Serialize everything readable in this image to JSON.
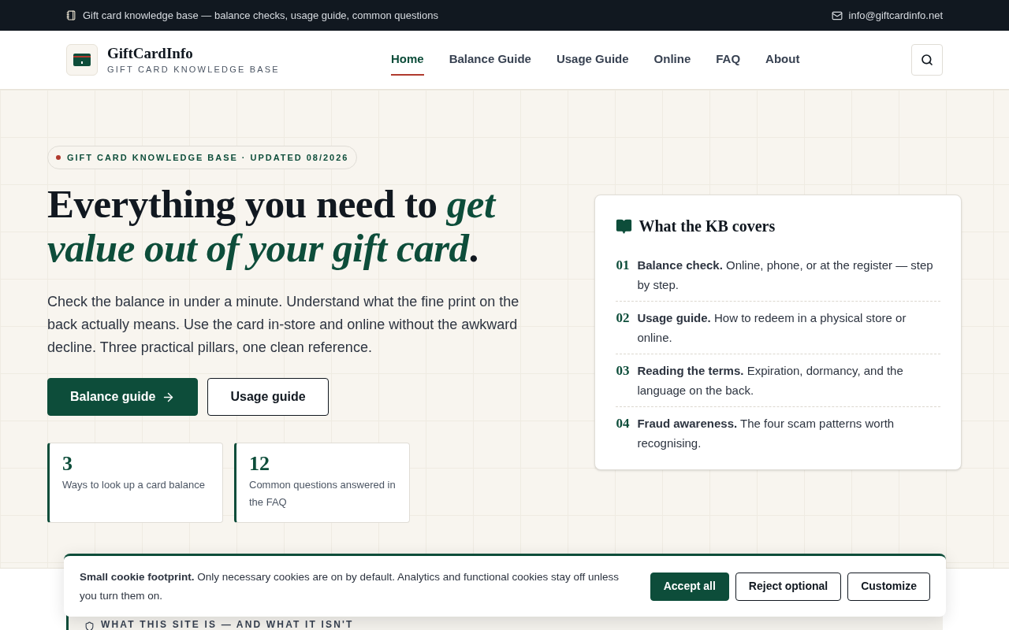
{
  "top_bar": {
    "tagline": "Gift card knowledge base — balance checks, usage guide, common questions",
    "email": "info@giftcardinfo.net"
  },
  "brand": {
    "name": "GiftCardInfo",
    "subtitle": "GIFT CARD KNOWLEDGE BASE"
  },
  "nav": [
    {
      "label": "Home",
      "selected": true
    },
    {
      "label": "Balance Guide",
      "selected": false
    },
    {
      "label": "Usage Guide",
      "selected": false
    },
    {
      "label": "Online",
      "selected": false
    },
    {
      "label": "FAQ",
      "selected": false
    },
    {
      "label": "About",
      "selected": false
    }
  ],
  "hero": {
    "eyebrow": "GIFT CARD KNOWLEDGE BASE · UPDATED 08/2026",
    "headline": "Everything you need to *get value out of your gift card*.",
    "lead": "Check the balance in under a minute. Understand what the fine print on the back actually means. Use the card in-store and online without the awkward decline. Three practical pillars, one clean reference.",
    "buttons": [
      {
        "label": "Balance guide",
        "kind": "primary"
      },
      {
        "label": "Usage guide",
        "kind": "secondary"
      }
    ],
    "stats": [
      {
        "value": "3",
        "label": "Ways to look up a card balance"
      },
      {
        "value": "12",
        "label": "Common questions answered in the FAQ"
      }
    ]
  },
  "covers": {
    "title": "What the KB covers",
    "items": [
      {
        "number": "01",
        "text": "**Balance check.** Online, phone, or at the register — step by step."
      },
      {
        "number": "02",
        "text": "**Usage guide.** How to redeem in a physical store or online."
      },
      {
        "number": "03",
        "text": "**Reading the terms.** Expiration, dormancy, and the language on the back."
      },
      {
        "number": "04",
        "text": "**Fraud awareness.** The four scam patterns worth recognising."
      }
    ]
  },
  "next_section": {
    "title": "WHAT THIS SITE IS — AND WHAT IT ISN'T"
  },
  "cookie_banner": {
    "text": "**Small cookie footprint.** Only necessary cookies are on by default. Analytics and functional cookies stay off unless you turn them on.",
    "buttons": [
      {
        "label": "Accept all",
        "kind": "primary"
      },
      {
        "label": "Reject optional",
        "kind": "secondary"
      },
      {
        "label": "Customize",
        "kind": "secondary"
      }
    ]
  }
}
